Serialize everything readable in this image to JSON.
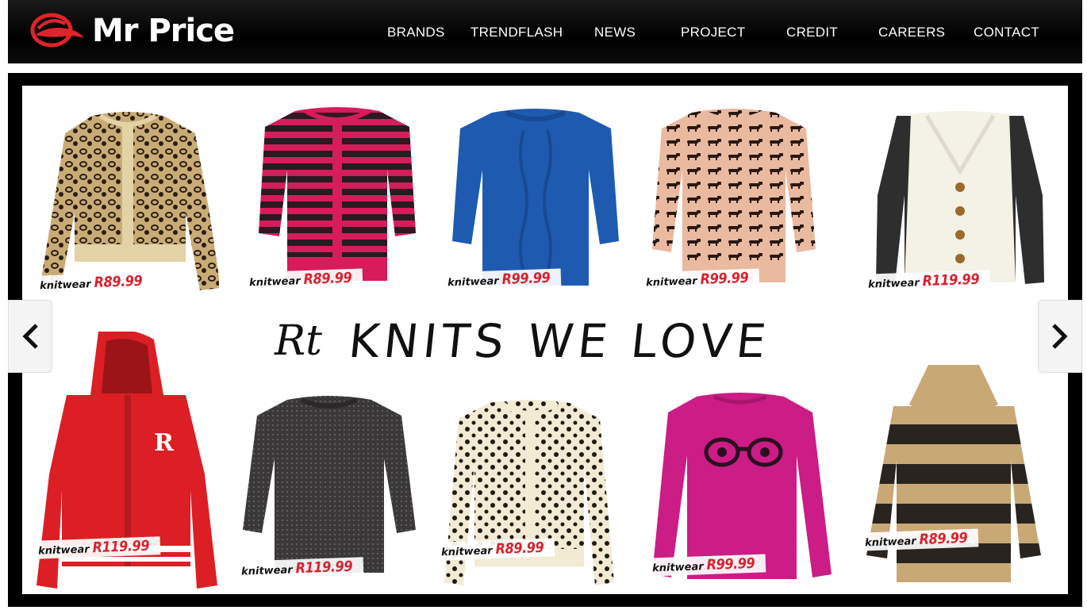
{
  "brand": {
    "name": "Mr Price",
    "logo_color": "#e0232b"
  },
  "nav": [
    "BRANDS",
    "TRENDFLASH",
    "NEWS",
    "PROJECT",
    "CREDIT",
    "CAREERS",
    "CONTACT"
  ],
  "banner": {
    "mark": "Rt",
    "headline": "KNITS WE LOVE",
    "prev_icon": "chevron-left-icon",
    "next_icon": "chevron-right-icon",
    "products": [
      {
        "label": "knitwear",
        "price": "R89.99",
        "item": "leopard print cardigan"
      },
      {
        "label": "knitwear",
        "price": "R89.99",
        "item": "pink and black striped cardigan"
      },
      {
        "label": "knitwear",
        "price": "R99.99",
        "item": "blue cable knit jersey"
      },
      {
        "label": "knitwear",
        "price": "R99.99",
        "item": "peach dachshund print jersey"
      },
      {
        "label": "knitwear",
        "price": "R119.99",
        "item": "cream cardigan with dark sleeves"
      },
      {
        "label": "knitwear",
        "price": "R119.99",
        "item": "red hooded varsity cardigan"
      },
      {
        "label": "knitwear",
        "price": "R119.99",
        "item": "charcoal sparkle jersey"
      },
      {
        "label": "knitwear",
        "price": "R89.99",
        "item": "cream polka dot cardigan"
      },
      {
        "label": "knitwear",
        "price": "R99.99",
        "item": "magenta glasses print jersey"
      },
      {
        "label": "knitwear",
        "price": "R89.99",
        "item": "tan and black striped polo neck jersey"
      }
    ]
  }
}
